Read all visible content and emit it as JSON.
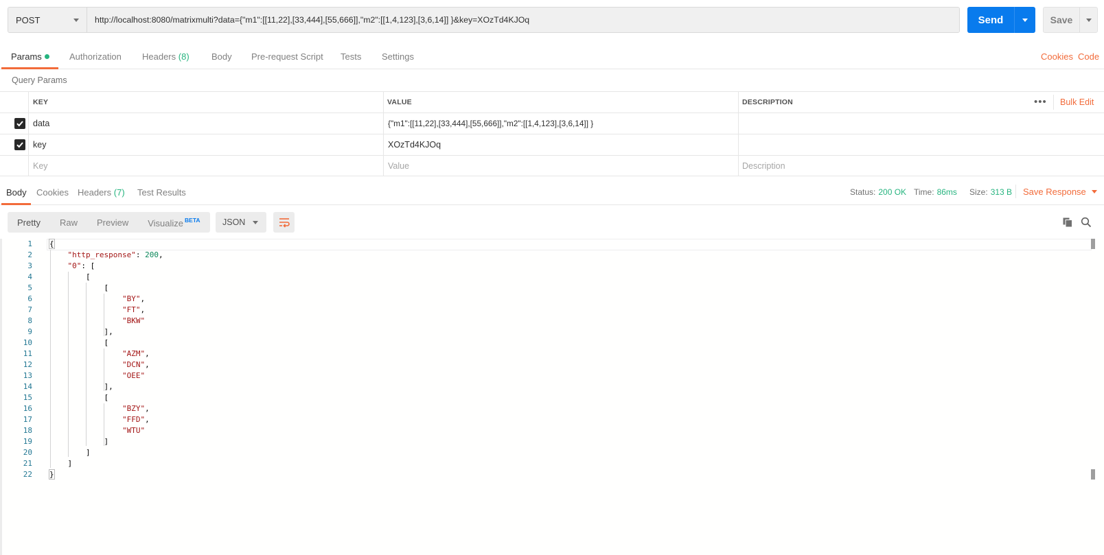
{
  "request": {
    "method": "POST",
    "url": "http://localhost:8080/matrixmulti?data={\"m1\":[[11,22],[33,444],[55,666]],\"m2\":[[1,4,123],[3,6,14]] }&key=XOzTd4KJOq",
    "send_label": "Send",
    "save_label": "Save"
  },
  "request_tabs": [
    {
      "label": "Params"
    },
    {
      "label": "Authorization"
    },
    {
      "label": "Headers",
      "count": "(8)"
    },
    {
      "label": "Body"
    },
    {
      "label": "Pre-request Script"
    },
    {
      "label": "Tests"
    },
    {
      "label": "Settings"
    }
  ],
  "right_links": {
    "cookies": "Cookies",
    "code": "Code"
  },
  "query_params": {
    "title": "Query Params",
    "headers": {
      "key": "KEY",
      "value": "VALUE",
      "description": "DESCRIPTION"
    },
    "more": "•••",
    "bulk_edit": "Bulk Edit",
    "rows": [
      {
        "checked": true,
        "key": "data",
        "value": "{\"m1\":[[11,22],[33,444],[55,666]],\"m2\":[[1,4,123],[3,6,14]] }",
        "description": ""
      },
      {
        "checked": true,
        "key": "key",
        "value": "XOzTd4KJOq",
        "description": ""
      }
    ],
    "placeholders": {
      "key": "Key",
      "value": "Value",
      "description": "Description"
    }
  },
  "response_tabs": [
    {
      "label": "Body"
    },
    {
      "label": "Cookies"
    },
    {
      "label": "Headers",
      "count": "(7)"
    },
    {
      "label": "Test Results"
    }
  ],
  "response_meta": {
    "status_label": "Status:",
    "status": "200 OK",
    "time_label": "Time:",
    "time": "86ms",
    "size_label": "Size:",
    "size": "313 B",
    "save_response": "Save Response"
  },
  "view_modes": [
    "Pretty",
    "Raw",
    "Preview",
    "Visualize"
  ],
  "beta_label": "BETA",
  "format": "JSON",
  "colors": {
    "accent": "#f26b3a",
    "primary": "#097bed",
    "success": "#26b47f"
  },
  "code_lines": [
    "{",
    "    \"http_response\": 200,",
    "    \"0\": [",
    "        [",
    "            [",
    "                \"BY\",",
    "                \"FT\",",
    "                \"BKW\"",
    "            ],",
    "            [",
    "                \"AZM\",",
    "                \"DCN\",",
    "                \"OEE\"",
    "            ],",
    "            [",
    "                \"BZY\",",
    "                \"FFD\",",
    "                \"WTU\"",
    "            ]",
    "        ]",
    "    ]",
    "}"
  ]
}
